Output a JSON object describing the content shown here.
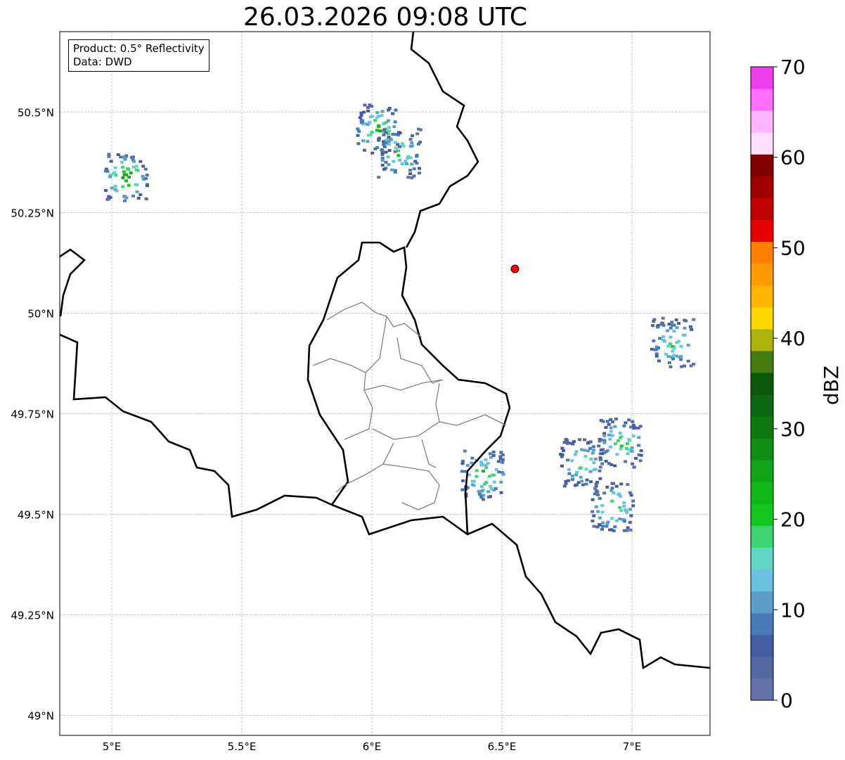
{
  "title": "26.03.2026 09:08 UTC",
  "info": {
    "product_line": "Product: 0.5° Reflectivity",
    "source_line": "Data: DWD"
  },
  "map": {
    "lon_range": [
      4.8,
      7.3
    ],
    "lat_range": [
      48.95,
      50.7
    ],
    "lon_ticks": [
      {
        "value": 5.0,
        "label": "5°E"
      },
      {
        "value": 5.5,
        "label": "5.5°E"
      },
      {
        "value": 6.0,
        "label": "6°E"
      },
      {
        "value": 6.5,
        "label": "6.5°E"
      },
      {
        "value": 7.0,
        "label": "7°E"
      }
    ],
    "lat_ticks": [
      {
        "value": 49.0,
        "label": "49°N"
      },
      {
        "value": 49.25,
        "label": "49.25°N"
      },
      {
        "value": 49.5,
        "label": "49.5°N"
      },
      {
        "value": 49.75,
        "label": "49.75°N"
      },
      {
        "value": 50.0,
        "label": "50°N"
      },
      {
        "value": 50.25,
        "label": "50.25°N"
      },
      {
        "value": 50.5,
        "label": "50.5°N"
      }
    ],
    "grid": true,
    "radar_site": {
      "lon": 6.55,
      "lat": 50.11,
      "color": "#ff0000"
    }
  },
  "colorbar": {
    "label": "dBZ",
    "ticks": [
      0,
      10,
      20,
      30,
      40,
      50,
      60,
      70
    ],
    "colors": [
      "#6472a8",
      "#52689f",
      "#425ea0",
      "#4a7ab5",
      "#5b9ec8",
      "#6ac3de",
      "#5fd6c4",
      "#3ed470",
      "#12c81e",
      "#10b81a",
      "#10a416",
      "#0e8e12",
      "#0c7a10",
      "#0a6810",
      "#0a560a",
      "#457a10",
      "#aab40a",
      "#ffd700",
      "#ffb600",
      "#ff9a00",
      "#ff7f00",
      "#e60000",
      "#c00000",
      "#a00000",
      "#800000",
      "#ffe0ff",
      "#ffb4ff",
      "#ff6eff",
      "#ee3cee"
    ]
  },
  "echoes": [
    {
      "lon": 5.05,
      "lat": 50.34,
      "dbz": 25
    },
    {
      "lon": 6.02,
      "lat": 50.46,
      "dbz": 22
    },
    {
      "lon": 6.1,
      "lat": 50.4,
      "dbz": 18
    },
    {
      "lon": 6.42,
      "lat": 49.6,
      "dbz": 22
    },
    {
      "lon": 6.92,
      "lat": 49.52,
      "dbz": 20
    },
    {
      "lon": 6.95,
      "lat": 49.68,
      "dbz": 20
    },
    {
      "lon": 7.15,
      "lat": 49.93,
      "dbz": 18
    },
    {
      "lon": 6.8,
      "lat": 49.63,
      "dbz": 18
    }
  ]
}
